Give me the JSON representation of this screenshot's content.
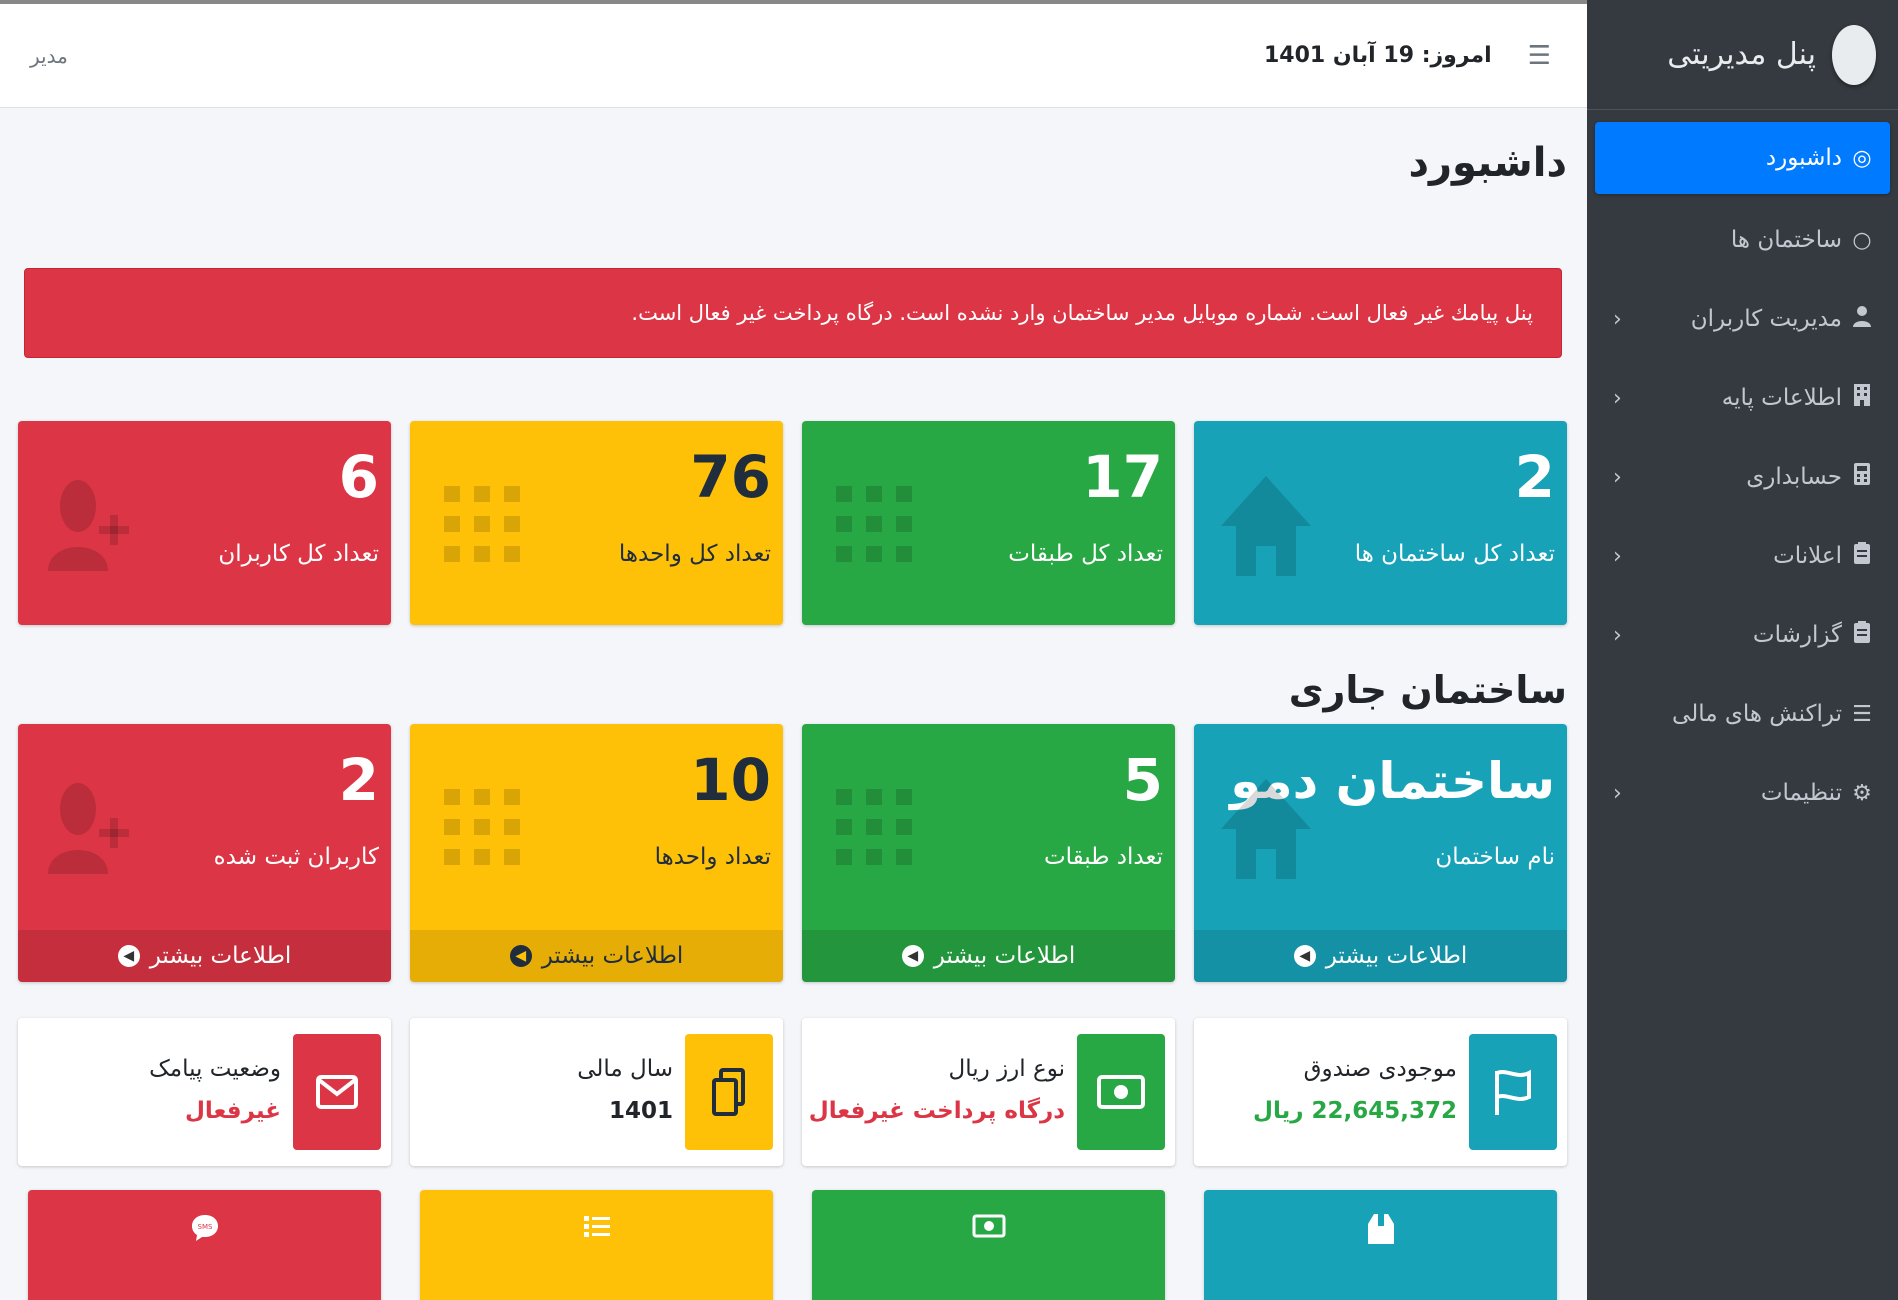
{
  "sidebar": {
    "brand": "پنل مدیریتی",
    "items": [
      {
        "label": "داشبورد",
        "icon": "dashboard-icon",
        "glyph": "◎",
        "active": true,
        "chevron": false
      },
      {
        "label": "ساختمان ها",
        "icon": "circle-icon",
        "glyph": "○",
        "active": false,
        "chevron": false
      },
      {
        "label": "مدیریت کاربران",
        "icon": "user-icon",
        "glyph": "👤",
        "active": false,
        "chevron": true
      },
      {
        "label": "اطلاعات پایه",
        "icon": "building-icon",
        "glyph": "▥",
        "active": false,
        "chevron": true
      },
      {
        "label": "حسابداری",
        "icon": "calculator-icon",
        "glyph": "▦",
        "active": false,
        "chevron": true
      },
      {
        "label": "اعلانات",
        "icon": "clipboard-icon",
        "glyph": "▤",
        "active": false,
        "chevron": true
      },
      {
        "label": "گزارشات",
        "icon": "report-icon",
        "glyph": "▤",
        "active": false,
        "chevron": true
      },
      {
        "label": "تراکنش های مالی",
        "icon": "list-icon",
        "glyph": "☰",
        "active": false,
        "chevron": false
      },
      {
        "label": "تنظیمات",
        "icon": "gear-icon",
        "glyph": "⚙",
        "active": false,
        "chevron": true
      }
    ]
  },
  "topbar": {
    "today_label": "امروز:",
    "today_date": "19 آبان 1401",
    "user": "مدیر"
  },
  "page_title": "داشبورد",
  "alert_text": "پنل پیامك غیر فعال است. شماره موبایل مدیر ساختمان وارد نشده است. درگاه پرداخت غیر فعال است.",
  "stats": [
    {
      "value": "2",
      "label": "تعداد کل ساختمان ها",
      "color": "#17a2b8",
      "icon": "home-icon"
    },
    {
      "value": "17",
      "label": "تعداد کل طبقات",
      "color": "#28a745",
      "icon": "grid-icon"
    },
    {
      "value": "76",
      "label": "تعداد کل واحدها",
      "color": "#ffc107",
      "icon": "grid-icon"
    },
    {
      "value": "6",
      "label": "تعداد کل کاربران",
      "color": "#dc3545",
      "icon": "user-plus-icon"
    }
  ],
  "current_building_title": "ساختمان جاری",
  "current": [
    {
      "value": "ساختمان دمو",
      "label": "نام ساختمان",
      "more": "اطلاعات بیشتر",
      "icon": "home-icon"
    },
    {
      "value": "5",
      "label": "تعداد طبقات",
      "more": "اطلاعات بیشتر",
      "icon": "grid-icon"
    },
    {
      "value": "10",
      "label": "تعداد واحدها",
      "more": "اطلاعات بیشتر",
      "icon": "grid-icon"
    },
    {
      "value": "2",
      "label": "کاربران ثبت شده",
      "more": "اطلاعات بیشتر",
      "icon": "user-plus-icon"
    }
  ],
  "info": [
    {
      "title": "موجودی صندوق",
      "value": "22,645,372 ریال",
      "value_color": "#28a745",
      "icon": "flag-icon"
    },
    {
      "title": "نوع ارز ریال",
      "value": "درگاه پرداخت غیرفعال",
      "value_color": "#dc3545",
      "icon": "money-icon"
    },
    {
      "title": "سال مالی",
      "value": "1401",
      "value_color": "#212529",
      "icon": "copy-icon"
    },
    {
      "title": "وضعیت پیامک",
      "value": "غیرفعال",
      "value_color": "#dc3545",
      "icon": "envelope-icon"
    }
  ],
  "tiles": [
    {
      "icon": "box-icon"
    },
    {
      "icon": "money-icon"
    },
    {
      "icon": "list-icon"
    },
    {
      "icon": "sms-icon"
    }
  ]
}
